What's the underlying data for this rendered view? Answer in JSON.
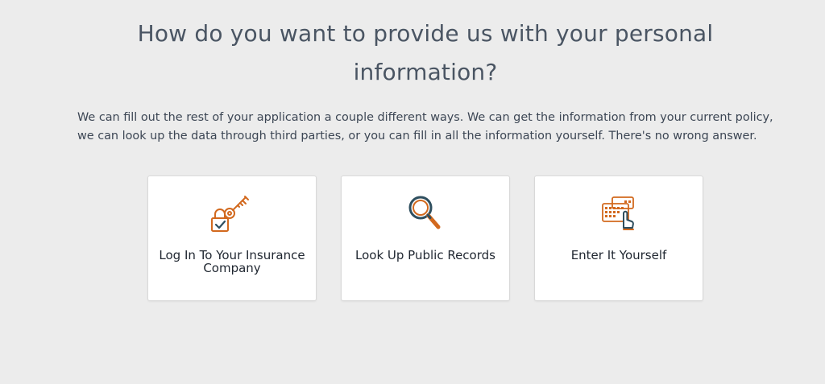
{
  "header": {
    "title": "How do you want to provide us with your personal information?"
  },
  "intro": {
    "text": "We can fill out the rest of your application a couple different ways. We can get the information from your current policy, we can look up the data through third parties, or you can fill in all the information yourself. There's no wrong answer."
  },
  "options": [
    {
      "label": "Log In To Your Insurance Company",
      "icon": "key-lock-icon"
    },
    {
      "label": "Look Up Public Records",
      "icon": "magnifying-glass-icon"
    },
    {
      "label": "Enter It Yourself",
      "icon": "keyboard-hand-icon"
    }
  ],
  "colors": {
    "background": "#ececec",
    "card": "#ffffff",
    "icon_primary": "#d2691e",
    "icon_secondary": "#2f4f5f",
    "text": "#3c4654"
  }
}
